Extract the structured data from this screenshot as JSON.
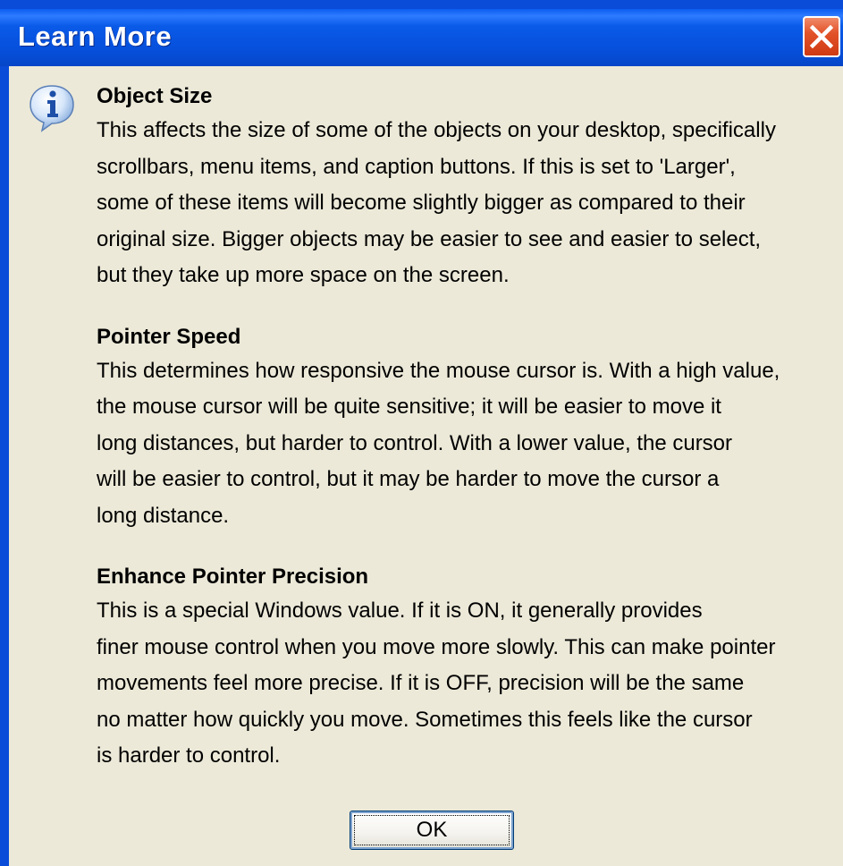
{
  "window": {
    "title": "Learn More"
  },
  "titlebar": {
    "close_icon": "close-icon"
  },
  "dialog": {
    "icon": "info-icon",
    "sections": [
      {
        "heading": "Object Size",
        "lines": [
          "This affects the size of some of the objects on your desktop, specifically",
          "scrollbars, menu items, and caption buttons. If this is set to 'Larger',",
          "some of these items will become slightly bigger as compared to their",
          "original size. Bigger objects may be easier to see and easier to select,",
          "but they take up more space on the screen."
        ]
      },
      {
        "heading": "Pointer Speed",
        "lines": [
          "This determines how responsive the mouse cursor is. With a high value,",
          "the mouse cursor will be quite sensitive; it will be easier to move it",
          "long distances, but harder to control. With a lower value, the cursor",
          "will be easier to control, but it may be harder to move the cursor a",
          "long distance."
        ]
      },
      {
        "heading": "Enhance Pointer Precision",
        "lines": [
          "This is a special Windows value. If it is ON, it generally provides",
          "finer mouse control when you move more slowly. This can make pointer",
          "movements feel more precise. If it is OFF, precision will be the same",
          "no matter how quickly you move. Sometimes this feels like the cursor",
          "is harder to control."
        ]
      }
    ],
    "ok_label": "OK"
  },
  "colors": {
    "titlebar": "#0A5AE8",
    "client_background": "#ECE9D8",
    "close_button": "#E2532A"
  }
}
